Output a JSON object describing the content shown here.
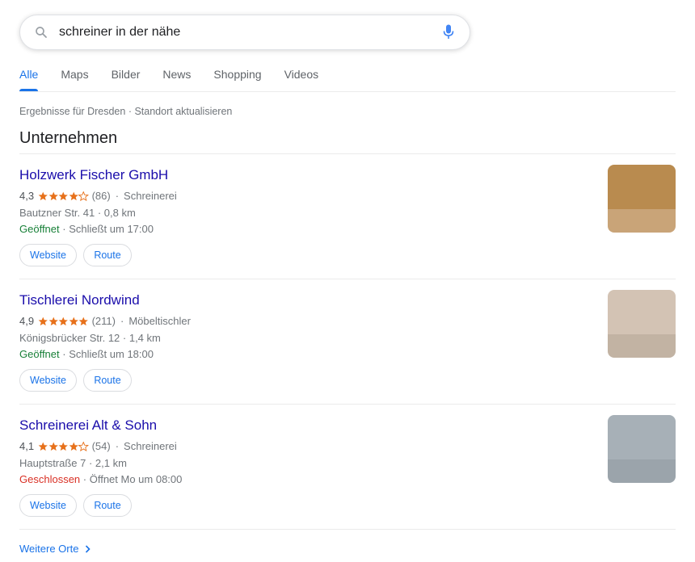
{
  "search": {
    "query": "schreiner in der nähe",
    "placeholder": ""
  },
  "tabs": [
    {
      "label": "Alle",
      "active": true
    },
    {
      "label": "Maps",
      "active": false
    },
    {
      "label": "Bilder",
      "active": false
    },
    {
      "label": "News",
      "active": false
    },
    {
      "label": "Shopping",
      "active": false
    },
    {
      "label": "Videos",
      "active": false
    }
  ],
  "location": {
    "prefix": "Ergebnisse für Dresden",
    "separator": "·",
    "update_link": "Standort aktualisieren"
  },
  "section_title": "Unternehmen",
  "businesses": [
    {
      "name": "Holzwerk Fischer GmbH",
      "rating": "4,3",
      "stars": 4.3,
      "review_count": "(86)",
      "category": "Schreinerei",
      "address": "Bautzner Str. 41 · 0,8 km",
      "status": "Geöffnet",
      "status_type": "open",
      "hours": "· Schließt um 17:00",
      "website_label": "Website",
      "route_label": "Route",
      "thumb_colors": [
        "#b98b4f",
        "#c9a478"
      ]
    },
    {
      "name": "Tischlerei Nordwind",
      "rating": "4,9",
      "stars": 4.9,
      "review_count": "(211)",
      "category": "Möbeltischler",
      "address": "Königsbrücker Str. 12 · 1,4 km",
      "status": "Geöffnet",
      "status_type": "open",
      "hours": "· Schließt um 18:00",
      "website_label": "Website",
      "route_label": "Route",
      "thumb_colors": [
        "#d3c3b4",
        "#c2b3a3"
      ]
    },
    {
      "name": "Schreinerei Alt & Sohn",
      "rating": "4,1",
      "stars": 4.1,
      "review_count": "(54)",
      "category": "Schreinerei",
      "address": "Hauptstraße 7 · 2,1 km",
      "status": "Geschlossen",
      "status_type": "closed",
      "hours": "· Öffnet Mo um 08:00",
      "website_label": "Website",
      "route_label": "Route",
      "thumb_colors": [
        "#a7b0b7",
        "#9ba4ab"
      ]
    }
  ],
  "more_link": "Weitere Orte",
  "colors": {
    "link_blue": "#1a73e8",
    "title_blue": "#1a0dab",
    "star_orange": "#e7711b",
    "open_green": "#188038",
    "closed_red": "#d93025"
  }
}
